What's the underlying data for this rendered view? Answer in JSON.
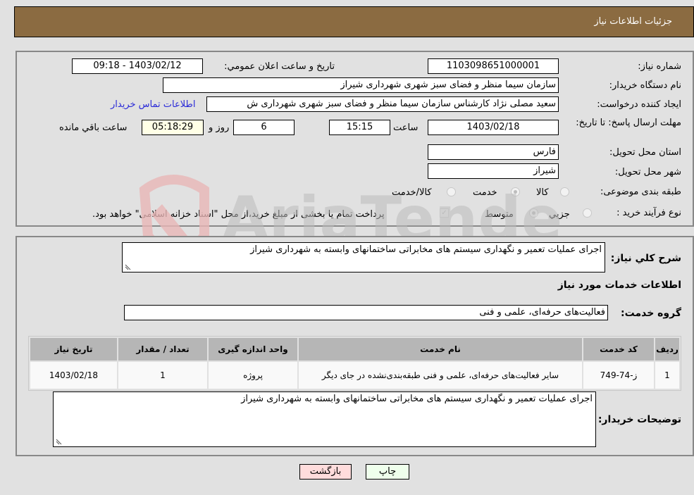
{
  "header": {
    "title": "جزئیات اطلاعات نیاز"
  },
  "form": {
    "need_number_label": "شماره نیاز:",
    "need_number": "1103098651000001",
    "announce_label": "تاریخ و ساعت اعلان عمومي:",
    "announce_value": "1403/02/12 - 09:18",
    "buyer_org_label": "نام دستگاه خریدار:",
    "buyer_org": "سازمان سیما منظر و فضای سبز شهری شهرداری شیراز",
    "creator_label": "ایجاد کننده درخواست:",
    "creator": "سعید مصلی نژاد کارشناس سازمان سیما منظر و فضای سبز شهری شهرداری ش",
    "contact_link": "اطلاعات تماس خریدار",
    "deadline_label": "مهلت ارسال پاسخ: تا تاریخ:",
    "deadline_date": "1403/02/18",
    "time_label": "ساعت",
    "deadline_time": "15:15",
    "days_value": "6",
    "days_label": "روز و",
    "remaining_value": "05:18:29",
    "remaining_label": "ساعت باقي مانده",
    "province_label": "استان محل تحویل:",
    "province": "فارس",
    "city_label": "شهر محل تحویل:",
    "city": "شیراز",
    "category_label": "طبقه بندی موضوعی:",
    "category_options": [
      {
        "label": "کالا",
        "checked": false
      },
      {
        "label": "خدمت",
        "checked": true
      },
      {
        "label": "کالا/خدمت",
        "checked": false
      }
    ],
    "process_label": "نوع فرآیند خرید :",
    "process_options": [
      {
        "label": "جزيي",
        "checked": false
      },
      {
        "label": "متوسط",
        "checked": true
      }
    ],
    "treasury_checkbox_label": "پرداخت تمام یا بخشی از مبلغ خرید،از محل \"اسناد خزانه اسلامی\" خواهد بود.",
    "treasury_checked": true
  },
  "details": {
    "summary_label": "شرح کلي نیاز:",
    "summary": "اجرای عملیات تعمیر و نگهداری سیستم های مخابراتی ساختمانهای وابسته به شهرداری شیراز",
    "services_heading": "اطلاعات خدمات مورد نیاز",
    "service_group_label": "گروه خدمت:",
    "service_group": "فعالیت‌های حرفه‌ای، علمی و فنی",
    "table": {
      "headers": [
        "ردیف",
        "کد خدمت",
        "نام خدمت",
        "واحد اندازه گیری",
        "تعداد / مقدار",
        "تاریخ نیاز"
      ],
      "rows": [
        [
          "1",
          "ز-74-749",
          "سایر فعالیت‌های حرفه‌ای، علمی و فنی طبقه‌بندی‌نشده در جای دیگر",
          "پروژه",
          "1",
          "1403/02/18"
        ]
      ]
    },
    "buyer_notes_label": "توضیحات خریدار:",
    "buyer_notes": "اجرای عملیات تعمیر و نگهداری سیستم های مخابراتی ساختمانهای وابسته به شهرداری شیراز"
  },
  "buttons": {
    "print": "چاپ",
    "back": "بازگشت"
  },
  "colors": {
    "header_bg": "#8b6b41",
    "print_bg": "#efffec",
    "back_bg": "#ffdcdc",
    "link": "#2a2ad8"
  }
}
